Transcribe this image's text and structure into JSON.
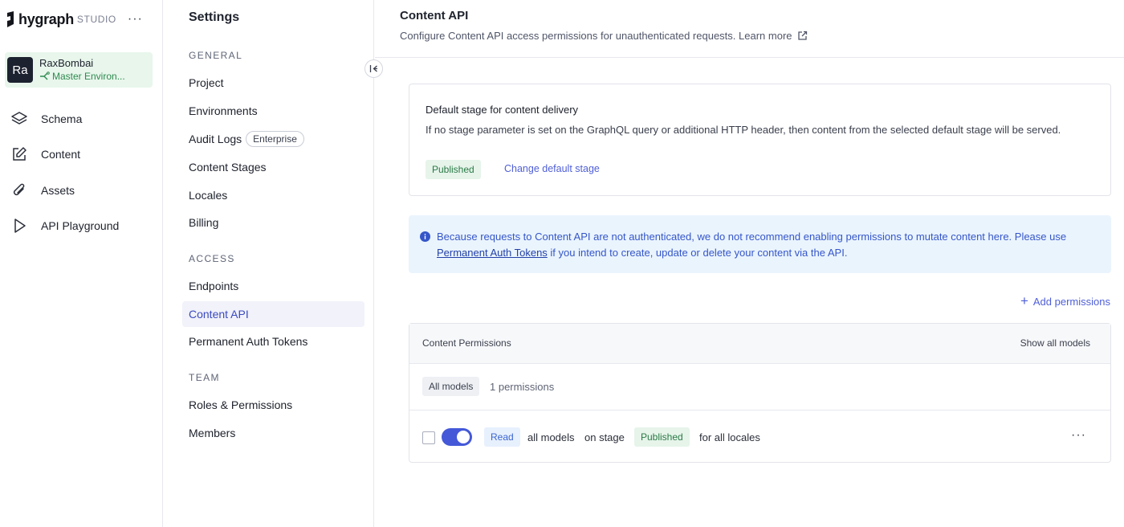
{
  "brand": {
    "name": "hygraph",
    "suffix": "STUDIO",
    "menu": "···"
  },
  "project": {
    "initials": "Ra",
    "name": "RaxBombai",
    "environment": "Master Environ..."
  },
  "nav": [
    {
      "label": "Schema",
      "icon": "layers-icon"
    },
    {
      "label": "Content",
      "icon": "edit-icon"
    },
    {
      "label": "Assets",
      "icon": "paperclip-icon"
    },
    {
      "label": "API Playground",
      "icon": "play-icon"
    }
  ],
  "settings": {
    "title": "Settings",
    "general_heading": "GENERAL",
    "general": [
      "Project",
      "Environments",
      "Audit Logs",
      "Content Stages",
      "Locales",
      "Billing"
    ],
    "enterprise_badge": "Enterprise",
    "access_heading": "ACCESS",
    "access": [
      "Endpoints",
      "Content API",
      "Permanent Auth Tokens"
    ],
    "team_heading": "TEAM",
    "team": [
      "Roles & Permissions",
      "Members"
    ],
    "active": "Content API"
  },
  "main": {
    "title": "Content API",
    "subtitle": "Configure Content API access permissions for unauthenticated requests.",
    "learn_more": "Learn more",
    "stage_card": {
      "title": "Default stage for content delivery",
      "description": "If no stage parameter is set on the GraphQL query or additional HTTP header, then content from the selected default stage will be served.",
      "stage": "Published",
      "change_link": "Change default stage"
    },
    "info": {
      "text_before": "Because requests to Content API are not authenticated, we do not recommend enabling permissions to mutate content here. Please use ",
      "link": "Permanent Auth Tokens",
      "text_after": " if you intend to create, update or delete your content via the API."
    },
    "add_permissions": "Add permissions",
    "permissions": {
      "header": "Content Permissions",
      "show_all": "Show all models",
      "filter_chip": "All models",
      "count": "1 permissions",
      "row": {
        "action": "Read",
        "models": "all models",
        "on_stage": "on stage",
        "stage": "Published",
        "locales": "for all locales",
        "enabled": true,
        "more": "···"
      }
    }
  },
  "colors": {
    "accent": "#4458d8",
    "published_bg": "#e6f4ea",
    "info_bg": "#eaf4fd"
  }
}
